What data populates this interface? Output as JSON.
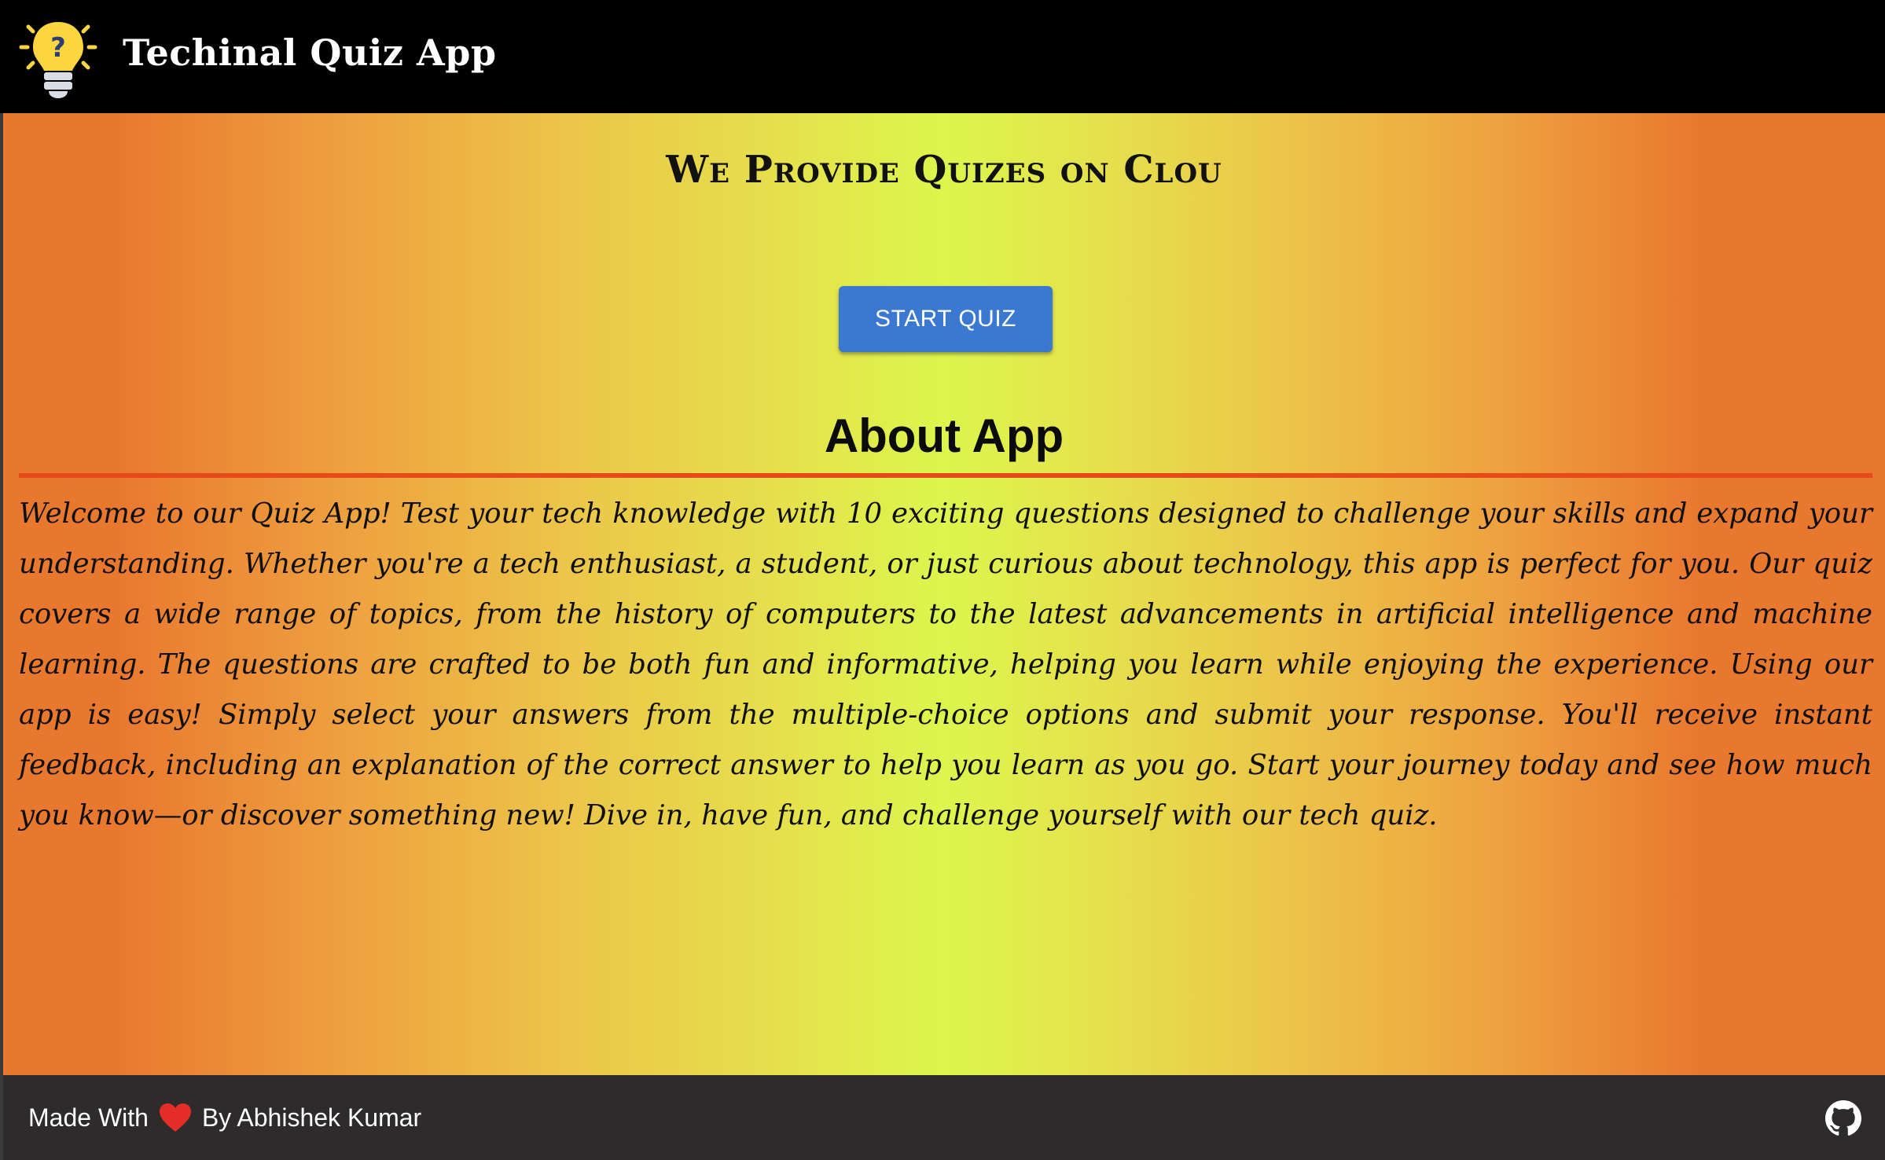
{
  "header": {
    "app_title": "Techinal Quiz App",
    "logo_icon": "lightbulb-question-icon",
    "logo_bulb_color": "#fcd53f",
    "logo_mark": "?"
  },
  "main": {
    "headline": "We Provide Quizes on Clou",
    "start_button_label": "START QUIZ",
    "about_title": "About App",
    "about_text": "Welcome to our Quiz App! Test your tech knowledge with 10 exciting questions designed to challenge your skills and expand your understanding. Whether you're a tech enthusiast, a student, or just curious about technology, this app is perfect for you. Our quiz covers a wide range of topics, from the history of computers to the latest advancements in artificial intelligence and machine learning. The questions are crafted to be both fun and informative, helping you learn while enjoying the experience. Using our app is easy! Simply select your answers from the multiple-choice options and submit your response. You'll receive instant feedback, including an explanation of the correct answer to help you learn as you go. Start your journey today and see how much you know—or discover something new! Dive in, have fun, and challenge yourself with our tech quiz."
  },
  "footer": {
    "made_with": "Made With",
    "by_author": "By Abhishek Kumar",
    "heart_icon": "heart-icon",
    "github_icon": "github-icon"
  },
  "colors": {
    "navbar": "#000000",
    "button": "#3a78d1",
    "divider": "#e64a19",
    "footer": "#2d2b2b",
    "gradient_edge": "#e9782f",
    "gradient_center": "#dcf64d"
  }
}
